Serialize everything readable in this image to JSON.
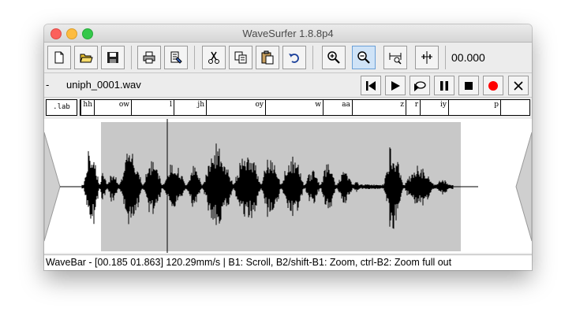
{
  "window": {
    "title": "WaveSurfer 1.8.8p4"
  },
  "toolbar": {
    "buttons": [
      {
        "name": "new-button",
        "icon": "new-document-icon"
      },
      {
        "name": "open-button",
        "icon": "open-folder-icon"
      },
      {
        "name": "save-button",
        "icon": "save-disk-icon"
      },
      {
        "name": "print-button",
        "icon": "printer-icon"
      },
      {
        "name": "properties-button",
        "icon": "properties-icon"
      },
      {
        "name": "cut-button",
        "icon": "scissors-icon"
      },
      {
        "name": "copy-button",
        "icon": "copy-icon"
      },
      {
        "name": "paste-button",
        "icon": "paste-icon"
      },
      {
        "name": "undo-button",
        "icon": "undo-icon"
      },
      {
        "name": "zoom-in-button",
        "icon": "zoom-in-icon"
      },
      {
        "name": "zoom-out-button",
        "icon": "zoom-out-icon"
      },
      {
        "name": "zoom-fit-button",
        "icon": "zoom-fit-icon"
      },
      {
        "name": "zoom-selection-button",
        "icon": "zoom-selection-icon"
      }
    ],
    "time": "00.000"
  },
  "file": {
    "dash": "-",
    "name": "uniph_0001.wav"
  },
  "playback": {
    "buttons": [
      "skip-to-start-icon",
      "play-icon",
      "play-loop-icon",
      "pause-icon",
      "stop-icon",
      "record-icon",
      "close-icon"
    ],
    "record_color": "#ff0000"
  },
  "labels": {
    "tag": ".lab",
    "items": [
      "hh",
      "ow",
      "l",
      "jh",
      "oy",
      "w",
      "aa",
      "z",
      "r",
      "iy",
      "p"
    ]
  },
  "waveform": {
    "selection": [
      0.185,
      1.863
    ],
    "selection_color": "#c8c8c8"
  },
  "status": {
    "text": "WaveBar - [00.185 01.863] 120.29mm/s | B1: Scroll, B2/shift-B1: Zoom, ctrl-B2: Zoom full out"
  }
}
